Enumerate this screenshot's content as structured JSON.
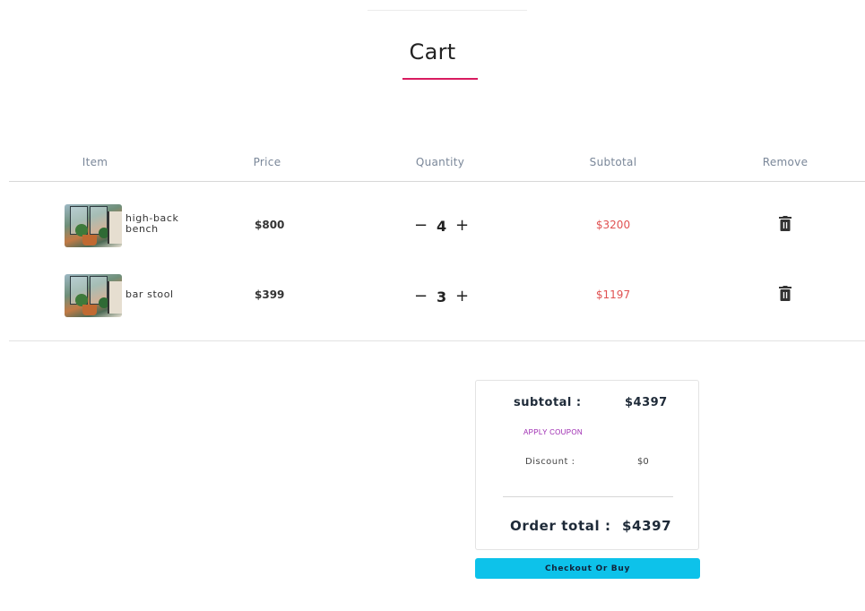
{
  "page": {
    "title": "Cart"
  },
  "table": {
    "headers": {
      "item": "Item",
      "price": "Price",
      "quantity": "Quantity",
      "subtotal": "Subtotal",
      "remove": "Remove"
    },
    "rows": [
      {
        "name": "high-back bench",
        "price": "$800",
        "quantity": "4",
        "subtotal": "$3200",
        "minus": "−",
        "plus": "+",
        "remove_icon": "trash-icon"
      },
      {
        "name": "bar stool",
        "price": "$399",
        "quantity": "3",
        "subtotal": "$1197",
        "minus": "−",
        "plus": "+",
        "remove_icon": "trash-icon"
      }
    ]
  },
  "summary": {
    "subtotal_label": "subtotal :",
    "subtotal_value": "$4397",
    "coupon_label": "APPLY COUPON",
    "discount_label": "Discount :",
    "discount_value": "$0",
    "total_label": "Order total :",
    "total_value": "$4397",
    "checkout_label": "Checkout Or Buy"
  },
  "colors": {
    "accent_underline": "#d81b60",
    "subtotal_text": "#e05252",
    "coupon_text": "#9c27b0",
    "checkout_bg": "#0dc2ea"
  }
}
